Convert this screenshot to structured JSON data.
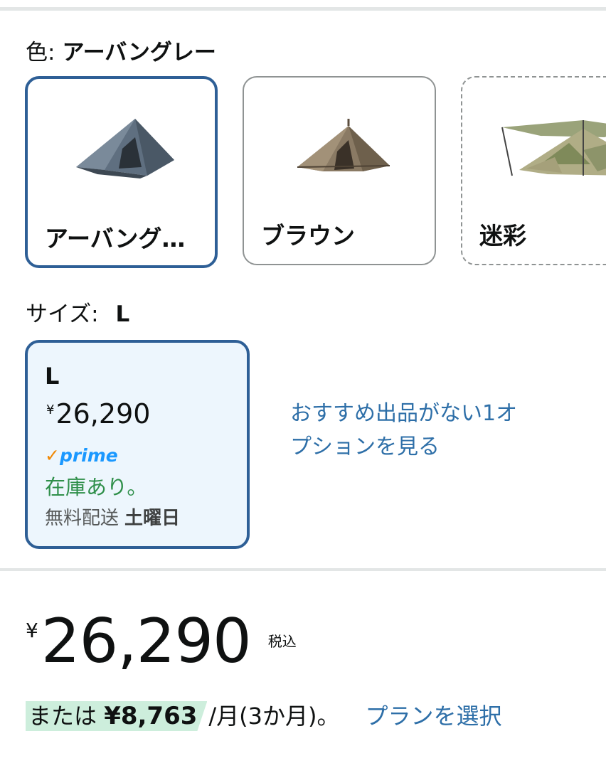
{
  "color_selector": {
    "label": "色:",
    "selected_value": "アーバングレー",
    "options": [
      {
        "label": "アーバング…",
        "state": "selected"
      },
      {
        "label": "ブラウン",
        "state": "available"
      },
      {
        "label": "迷彩",
        "state": "unavailable"
      }
    ]
  },
  "size_selector": {
    "label": "サイズ:",
    "selected_value": "L",
    "card": {
      "name": "L",
      "currency": "¥",
      "price": "26,290",
      "prime_check": "✓",
      "prime": "prime",
      "stock": "在庫あり。",
      "shipping_label": "無料配送",
      "shipping_day": "土曜日"
    },
    "other_options_link": "おすすめ出品がない1オプションを見る"
  },
  "price": {
    "currency": "¥",
    "amount": "26,290",
    "tax_note": "税込"
  },
  "installment": {
    "prefix": "または",
    "amount": "¥8,763",
    "suffix": "/月(3か月)。",
    "plan_link": "プランを選択"
  },
  "colors": {
    "accent_border": "#2e5f96",
    "link": "#2e6fa8",
    "in_stock": "#2f8f4a",
    "prime": "#1a98ff",
    "highlight": "#cdeedc"
  }
}
